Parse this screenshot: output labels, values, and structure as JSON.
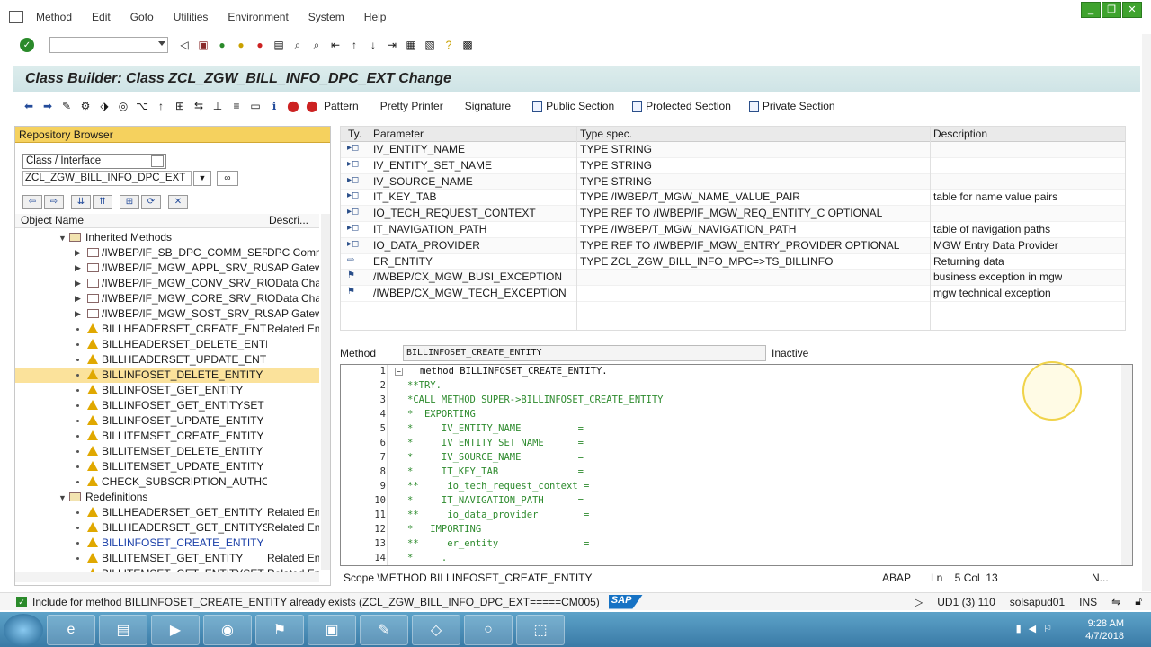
{
  "menu": [
    "Method",
    "Edit",
    "Goto",
    "Utilities",
    "Environment",
    "System",
    "Help"
  ],
  "window_controls": [
    "_",
    "❐",
    "✕"
  ],
  "title": "Class Builder: Class ZCL_ZGW_BILL_INFO_DPC_EXT Change",
  "app_toolbar": {
    "pattern": "Pattern",
    "pretty_printer": "Pretty Printer",
    "signature": "Signature",
    "public_section": "Public Section",
    "protected_section": "Protected Section",
    "private_section": "Private Section"
  },
  "repo": {
    "header": "Repository Browser",
    "type_select": "Class / Interface",
    "object_input": "ZCL_ZGW_BILL_INFO_DPC_EXT",
    "col_name": "Object Name",
    "col_desc": "Descri...",
    "tree": [
      {
        "kind": "folder-open",
        "indent": 0,
        "name": "Inherited Methods",
        "desc": ""
      },
      {
        "kind": "folder",
        "indent": 1,
        "name": "/IWBEP/IF_SB_DPC_COMM_SERVICES",
        "desc": "DPC Comm"
      },
      {
        "kind": "folder",
        "indent": 1,
        "name": "/IWBEP/IF_MGW_APPL_SRV_RUNTIME",
        "desc": "SAP Gatew"
      },
      {
        "kind": "folder",
        "indent": 1,
        "name": "/IWBEP/IF_MGW_CONV_SRV_RUNTIME",
        "desc": "OData Char"
      },
      {
        "kind": "folder",
        "indent": 1,
        "name": "/IWBEP/IF_MGW_CORE_SRV_RUNTIME",
        "desc": "OData Char"
      },
      {
        "kind": "folder",
        "indent": 1,
        "name": "/IWBEP/IF_MGW_SOST_SRV_RUNTIME",
        "desc": "SAP Gatew"
      },
      {
        "kind": "method",
        "indent": 1,
        "name": "BILLHEADERSET_CREATE_ENTITY",
        "desc": "Related En"
      },
      {
        "kind": "method",
        "indent": 1,
        "name": "BILLHEADERSET_DELETE_ENTITY",
        "desc": ""
      },
      {
        "kind": "method",
        "indent": 1,
        "name": "BILLHEADERSET_UPDATE_ENTITY",
        "desc": ""
      },
      {
        "kind": "method-sel",
        "indent": 1,
        "name": "BILLINFOSET_DELETE_ENTITY",
        "desc": ""
      },
      {
        "kind": "method",
        "indent": 1,
        "name": "BILLINFOSET_GET_ENTITY",
        "desc": ""
      },
      {
        "kind": "method",
        "indent": 1,
        "name": "BILLINFOSET_GET_ENTITYSET",
        "desc": ""
      },
      {
        "kind": "method",
        "indent": 1,
        "name": "BILLINFOSET_UPDATE_ENTITY",
        "desc": ""
      },
      {
        "kind": "method",
        "indent": 1,
        "name": "BILLITEMSET_CREATE_ENTITY",
        "desc": ""
      },
      {
        "kind": "method",
        "indent": 1,
        "name": "BILLITEMSET_DELETE_ENTITY",
        "desc": ""
      },
      {
        "kind": "method",
        "indent": 1,
        "name": "BILLITEMSET_UPDATE_ENTITY",
        "desc": ""
      },
      {
        "kind": "method",
        "indent": 1,
        "name": "CHECK_SUBSCRIPTION_AUTHORITY",
        "desc": ""
      },
      {
        "kind": "folder-open",
        "indent": 0,
        "name": "Redefinitions",
        "desc": ""
      },
      {
        "kind": "method",
        "indent": 1,
        "name": "BILLHEADERSET_GET_ENTITY",
        "desc": "Related En"
      },
      {
        "kind": "method",
        "indent": 1,
        "name": "BILLHEADERSET_GET_ENTITYSET",
        "desc": "Related En"
      },
      {
        "kind": "method-link",
        "indent": 1,
        "name": "BILLINFOSET_CREATE_ENTITY",
        "desc": ""
      },
      {
        "kind": "method",
        "indent": 1,
        "name": "BILLITEMSET_GET_ENTITY",
        "desc": "Related En"
      },
      {
        "kind": "method",
        "indent": 1,
        "name": "BILLITEMSET_GET_ENTITYSET",
        "desc": "Related En"
      }
    ]
  },
  "params": {
    "headers": {
      "ty": "Ty.",
      "param": "Parameter",
      "type": "Type spec.",
      "desc": "Description"
    },
    "rows": [
      {
        "ty": "▸◻",
        "param": "IV_ENTITY_NAME",
        "type": "TYPE STRING",
        "desc": ""
      },
      {
        "ty": "▸◻",
        "param": "IV_ENTITY_SET_NAME",
        "type": "TYPE STRING",
        "desc": ""
      },
      {
        "ty": "▸◻",
        "param": "IV_SOURCE_NAME",
        "type": "TYPE STRING",
        "desc": ""
      },
      {
        "ty": "▸◻",
        "param": "IT_KEY_TAB",
        "type": "TYPE /IWBEP/T_MGW_NAME_VALUE_PAIR",
        "desc": "table for name value pairs"
      },
      {
        "ty": "▸◻",
        "param": "IO_TECH_REQUEST_CONTEXT",
        "type": "TYPE REF TO /IWBEP/IF_MGW_REQ_ENTITY_C OPTIONAL",
        "desc": ""
      },
      {
        "ty": "▸◻",
        "param": "IT_NAVIGATION_PATH",
        "type": "TYPE /IWBEP/T_MGW_NAVIGATION_PATH",
        "desc": "table of navigation paths"
      },
      {
        "ty": "▸◻",
        "param": "IO_DATA_PROVIDER",
        "type": "TYPE REF TO /IWBEP/IF_MGW_ENTRY_PROVIDER OPTIONAL",
        "desc": "MGW Entry Data Provider"
      },
      {
        "ty": "⇨",
        "param": "ER_ENTITY",
        "type": "TYPE ZCL_ZGW_BILL_INFO_MPC=>TS_BILLINFO",
        "desc": "Returning data"
      },
      {
        "ty": "⚑",
        "param": "/IWBEP/CX_MGW_BUSI_EXCEPTION",
        "type": "",
        "desc": "business exception in mgw"
      },
      {
        "ty": "⚑",
        "param": "/IWBEP/CX_MGW_TECH_EXCEPTION",
        "type": "",
        "desc": "mgw technical exception"
      }
    ]
  },
  "method_bar": {
    "label": "Method",
    "value": "BILLINFOSET_CREATE_ENTITY",
    "status": "Inactive"
  },
  "code": [
    {
      "n": "1",
      "t": "method BILLINFOSET_CREATE_ENTITY.",
      "k": true
    },
    {
      "n": "2",
      "t": "**TRY."
    },
    {
      "n": "3",
      "t": "*CALL METHOD SUPER->BILLINFOSET_CREATE_ENTITY"
    },
    {
      "n": "4",
      "t": "*  EXPORTING"
    },
    {
      "n": "5",
      "t": "*     IV_ENTITY_NAME          ="
    },
    {
      "n": "6",
      "t": "*     IV_ENTITY_SET_NAME      ="
    },
    {
      "n": "7",
      "t": "*     IV_SOURCE_NAME          ="
    },
    {
      "n": "8",
      "t": "*     IT_KEY_TAB              ="
    },
    {
      "n": "9",
      "t": "**     io_tech_request_context ="
    },
    {
      "n": "10",
      "t": "*     IT_NAVIGATION_PATH      ="
    },
    {
      "n": "11",
      "t": "**     io_data_provider        ="
    },
    {
      "n": "12",
      "t": "*   IMPORTING"
    },
    {
      "n": "13",
      "t": "**     er_entity               ="
    },
    {
      "n": "14",
      "t": "*     ."
    }
  ],
  "editor_status": {
    "scope": "Scope \\METHOD BILLINFOSET_CREATE_ENTITY",
    "lang": "ABAP",
    "pos": "Ln    5 Col  13",
    "mode": "N..."
  },
  "status": {
    "message": "Include for method BILLINFOSET_CREATE_ENTITY already exists (ZCL_ZGW_BILL_INFO_DPC_EXT=====CM005)",
    "system": "UD1 (3) 110",
    "server": "solsapud01",
    "ins": "INS"
  },
  "taskbar": {
    "time": "9:28 AM",
    "date": "4/7/2018"
  },
  "colors": {
    "title_bg": "#cfe4e6",
    "repo_header": "#f5d15e",
    "selection": "#fbe29b",
    "comment_green": "#2e8b2e",
    "taskbar": "#3a7aa6"
  }
}
